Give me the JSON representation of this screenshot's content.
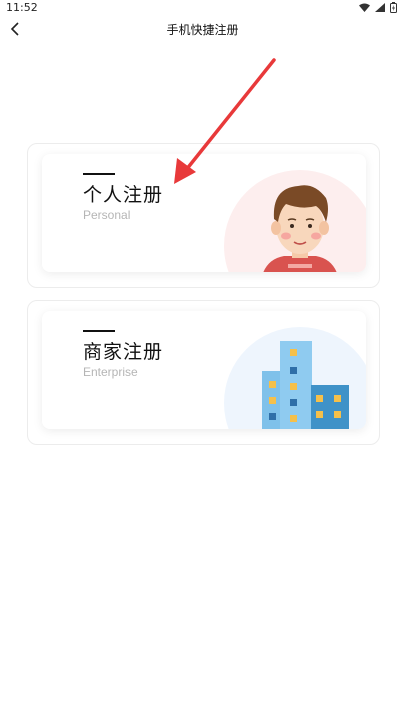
{
  "status": {
    "time": "11:52"
  },
  "header": {
    "title": "手机快捷注册"
  },
  "cards": [
    {
      "title": "个人注册",
      "subtitle": "Personal"
    },
    {
      "title": "商家注册",
      "subtitle": "Enterprise"
    }
  ],
  "colors": {
    "annotation_arrow": "#e8393a",
    "avatar_bg": "#fdeeee",
    "building_bg": "#eef5fd"
  },
  "icons": [
    "back-arrow-icon",
    "wifi-icon",
    "signal-icon",
    "battery-icon",
    "person-avatar-icon",
    "buildings-icon"
  ]
}
